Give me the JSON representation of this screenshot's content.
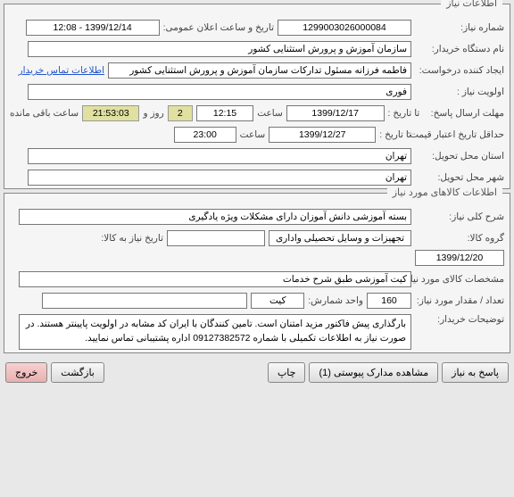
{
  "sections": {
    "need_info_title": "اطلاعات نیاز",
    "goods_info_title": "اطلاعات کالاهای مورد نیاز"
  },
  "need": {
    "need_no_label": "شماره نیاز:",
    "need_no": "1299003026000084",
    "announce_label": "تاریخ و ساعت اعلان عمومی:",
    "announce_value": "1399/12/14 - 12:08",
    "buyer_org_label": "نام دستگاه خریدار:",
    "buyer_org": "سازمان آموزش و پرورش استثنایی کشور",
    "requester_label": "ایجاد کننده درخواست:",
    "requester": "فاطمه فرزانه مسئول تدارکات سازمان آموزش و پرورش استثنایی کشور",
    "contact_link": "اطلاعات تماس خریدار",
    "priority_label": "اولویت نیاز :",
    "priority": "فوری",
    "deadline_label": "مهلت ارسال پاسخ:",
    "to_date_label": "تا تاریخ :",
    "deadline_date": "1399/12/17",
    "time_label": "ساعت",
    "deadline_time": "12:15",
    "remain_days": "2",
    "days_and": "روز و",
    "remain_time": "21:53:03",
    "remain_suffix": "ساعت باقی مانده",
    "min_credit_label": "حداقل تاریخ اعتبار قیمت:",
    "credit_date": "1399/12/27",
    "credit_time": "23:00",
    "delivery_state_label": "استان محل تحویل:",
    "delivery_state": "تهران",
    "delivery_city_label": "شهر محل تحویل:",
    "delivery_city": "تهران"
  },
  "goods": {
    "gen_desc_label": "شرح کلی نیاز:",
    "gen_desc": "بسته آموزشی دانش آموزان دارای مشکلات ویژه یادگیری",
    "group_label": "گروه کالا:",
    "group": "تجهیزات و وسایل تحصیلی واداری",
    "need_date_label": "تاریخ نیاز به کالا:",
    "need_date": "1399/12/20",
    "spec_label": "مشخصات کالای مورد نیاز:",
    "spec": "کیت آموزشی طبق شرح خدمات",
    "qty_label": "تعداد / مقدار مورد نیاز:",
    "qty": "160",
    "unit_label": "واحد شمارش:",
    "unit": "کیت",
    "index_label": "",
    "notes_label": "توضیحات خریدار:",
    "notes": "بارگذاری پیش فاکتور مزید امتنان است. تامین کنندگان با ایران کد مشابه در اولویت پایینتر هستند. در صورت نیاز به اطلاعات تکمیلی با شماره 09127382572 اداره پشتیبانی تماس نمایید."
  },
  "buttons": {
    "respond": "پاسخ به نیاز",
    "attachments": "مشاهده مدارک پیوستی  (1)",
    "print": "چاپ",
    "back": "بازگشت",
    "exit": "خروج"
  }
}
